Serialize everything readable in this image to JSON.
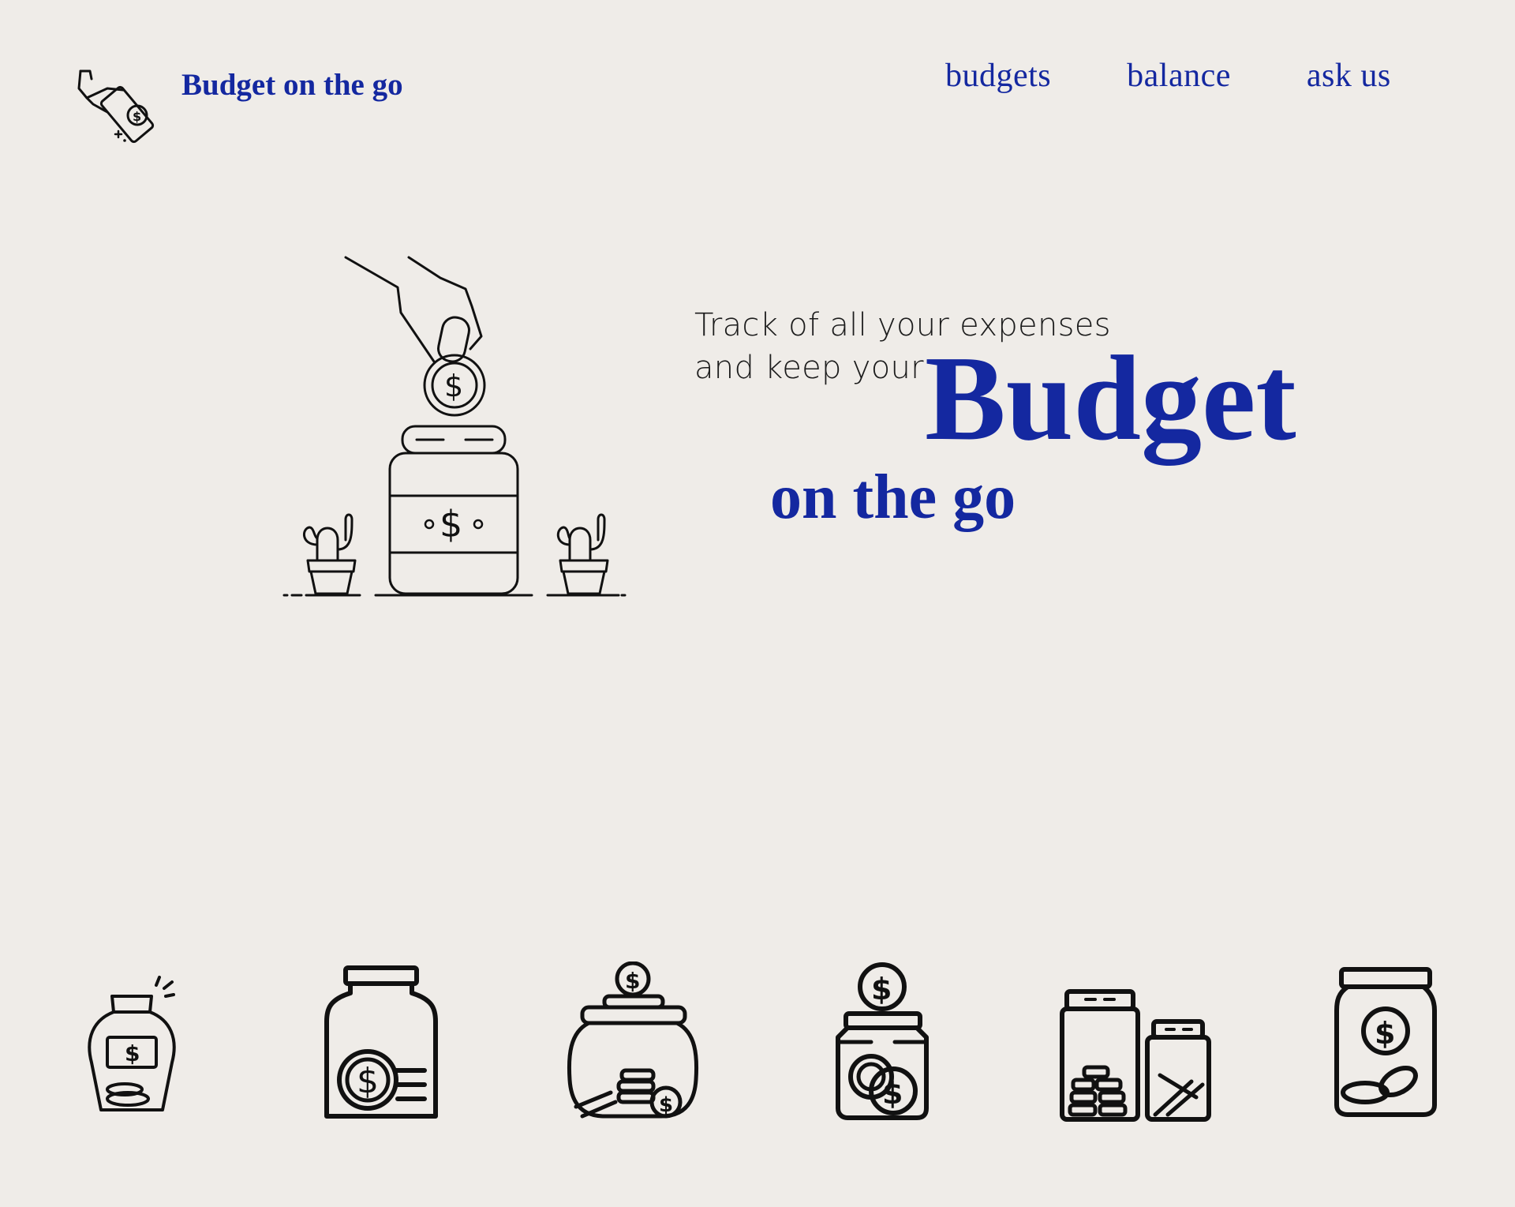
{
  "brand": {
    "name": "Budget on the go",
    "logo_icon": "hand-money-icon"
  },
  "nav": {
    "items": [
      {
        "label": "budgets"
      },
      {
        "label": "balance"
      },
      {
        "label": "ask us"
      }
    ]
  },
  "hero": {
    "tagline_line1": "Track of all your expenses",
    "tagline_line2": "and keep your",
    "title_big": "Budget",
    "title_sub": "on the go",
    "illustration_icon": "coin-jar-illustration"
  },
  "jars": [
    {
      "icon": "coin-bottle-icon"
    },
    {
      "icon": "money-jar-icon"
    },
    {
      "icon": "cookie-jar-coins-icon"
    },
    {
      "icon": "coin-jar-icon"
    },
    {
      "icon": "two-jars-coins-icon"
    },
    {
      "icon": "savings-jar-icon"
    }
  ],
  "colors": {
    "accent": "#1428a0",
    "background": "#efece8",
    "text": "#1c1c1c"
  }
}
